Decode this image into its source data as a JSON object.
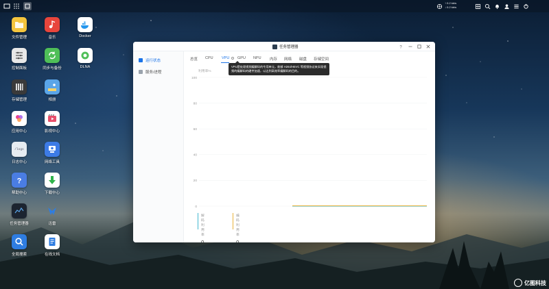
{
  "topbar": {
    "net_up": "↑ 0.2 kb/s",
    "net_down": "↓ 0.2 kb/s"
  },
  "desktop": {
    "icons": [
      {
        "label": "文件管理",
        "icon": "folder-icon",
        "color": "#f3c33c"
      },
      {
        "label": "音乐",
        "icon": "music-icon",
        "color": "#e8453c"
      },
      {
        "label": "Docker",
        "icon": "docker-icon",
        "color": "#ffffff"
      },
      {
        "label": "控制面板",
        "icon": "control-panel-icon",
        "color": "#e8e8e8"
      },
      {
        "label": "同步与备份",
        "icon": "sync-icon",
        "color": "#4fbf58"
      },
      {
        "label": "DLNA",
        "icon": "dlna-icon",
        "color": "#ffffff"
      },
      {
        "label": "存储管理",
        "icon": "storage-icon",
        "color": "#3a3a3a"
      },
      {
        "label": "相册",
        "icon": "photo-icon",
        "color": "#5aa5e8"
      },
      {
        "label": "应用中心",
        "icon": "app-center-icon",
        "color": "#ffffff"
      },
      {
        "label": "影视中心",
        "icon": "video-icon",
        "color": "#ffffff"
      },
      {
        "label": "日志中心",
        "icon": "log-icon",
        "color": "#e6ecf2"
      },
      {
        "label": "网络工具",
        "icon": "network-tools-icon",
        "color": "#3d7be6"
      },
      {
        "label": "帮助中心",
        "icon": "help-icon",
        "color": "#4a7de3"
      },
      {
        "label": "下载中心",
        "icon": "download-icon",
        "color": "#ffffff"
      },
      {
        "label": "任务管理器",
        "icon": "task-manager-icon",
        "color": "#1c2430"
      },
      {
        "label": "迅雷",
        "icon": "thunder-icon",
        "color": "#2f7de1"
      },
      {
        "label": "全局搜索",
        "icon": "search-icon",
        "color": "#2f7de1"
      },
      {
        "label": "在线文档",
        "icon": "docs-icon",
        "color": "#ffffff"
      }
    ],
    "log_tile_text": "/logs"
  },
  "window": {
    "title": "任务管理器",
    "sidebar": [
      {
        "label": "运行状态",
        "active": true
      },
      {
        "label": "服务/进程",
        "active": false
      }
    ],
    "tabs": [
      "总览",
      "CPU",
      "VPU",
      "GPU",
      "NPU",
      "内存",
      "网络",
      "磁盘",
      "存储空间"
    ],
    "active_tab": "VPU",
    "tooltip": "VPU是处理视频编解码的专用单元，能够 H264/HEVC 等视频协议来实现视频的编解码的硬件加速，以达到高效率编解码的目的。",
    "yaxis_title": "利用率%",
    "stats": [
      {
        "label": "解码利用率",
        "value": "0 %",
        "color": "#43b8d0"
      },
      {
        "label": "编码利用率",
        "value": "0 %",
        "color": "#e8b23c"
      }
    ]
  },
  "chart_data": {
    "type": "line",
    "ylabel": "利用率%",
    "ylim": [
      0,
      100
    ],
    "yticks": [
      100,
      80,
      60,
      40,
      20,
      0
    ],
    "series": [
      {
        "name": "解码利用率",
        "values": [
          0,
          0,
          0,
          0,
          0
        ],
        "color": "#43b8d0"
      },
      {
        "name": "编码利用率",
        "values": [
          0,
          0,
          0,
          0,
          0
        ],
        "color": "#e8b23c"
      }
    ]
  },
  "watermark": {
    "text": "亿图科技"
  }
}
